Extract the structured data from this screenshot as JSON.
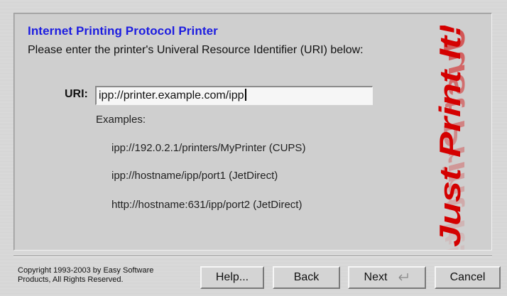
{
  "wizard": {
    "title": "Internet Printing Protocol Printer",
    "subtitle": "Please enter the printer's Univeral Resource Identifier (URI) below:",
    "uri_label": "URI:",
    "uri_value": "ipp://printer.example.com/ipp",
    "examples_label": "Examples:",
    "examples": [
      "ipp://192.0.2.1/printers/MyPrinter (CUPS)",
      "ipp://hostname/ipp/port1 (JetDirect)",
      "http://hostname:631/ipp/port2 (JetDirect)"
    ],
    "logo_text": "Just Print It!"
  },
  "footer": {
    "copyright_line1": "Copyright 1993-2003 by Easy Software",
    "copyright_line2": "Products, All Rights Reserved.",
    "help_label": "Help...",
    "back_label": "Back",
    "next_label": "Next",
    "cancel_label": "Cancel"
  },
  "colors": {
    "title": "#1c1ce0",
    "logo": "#d40000",
    "background": "#d9d9d9"
  }
}
